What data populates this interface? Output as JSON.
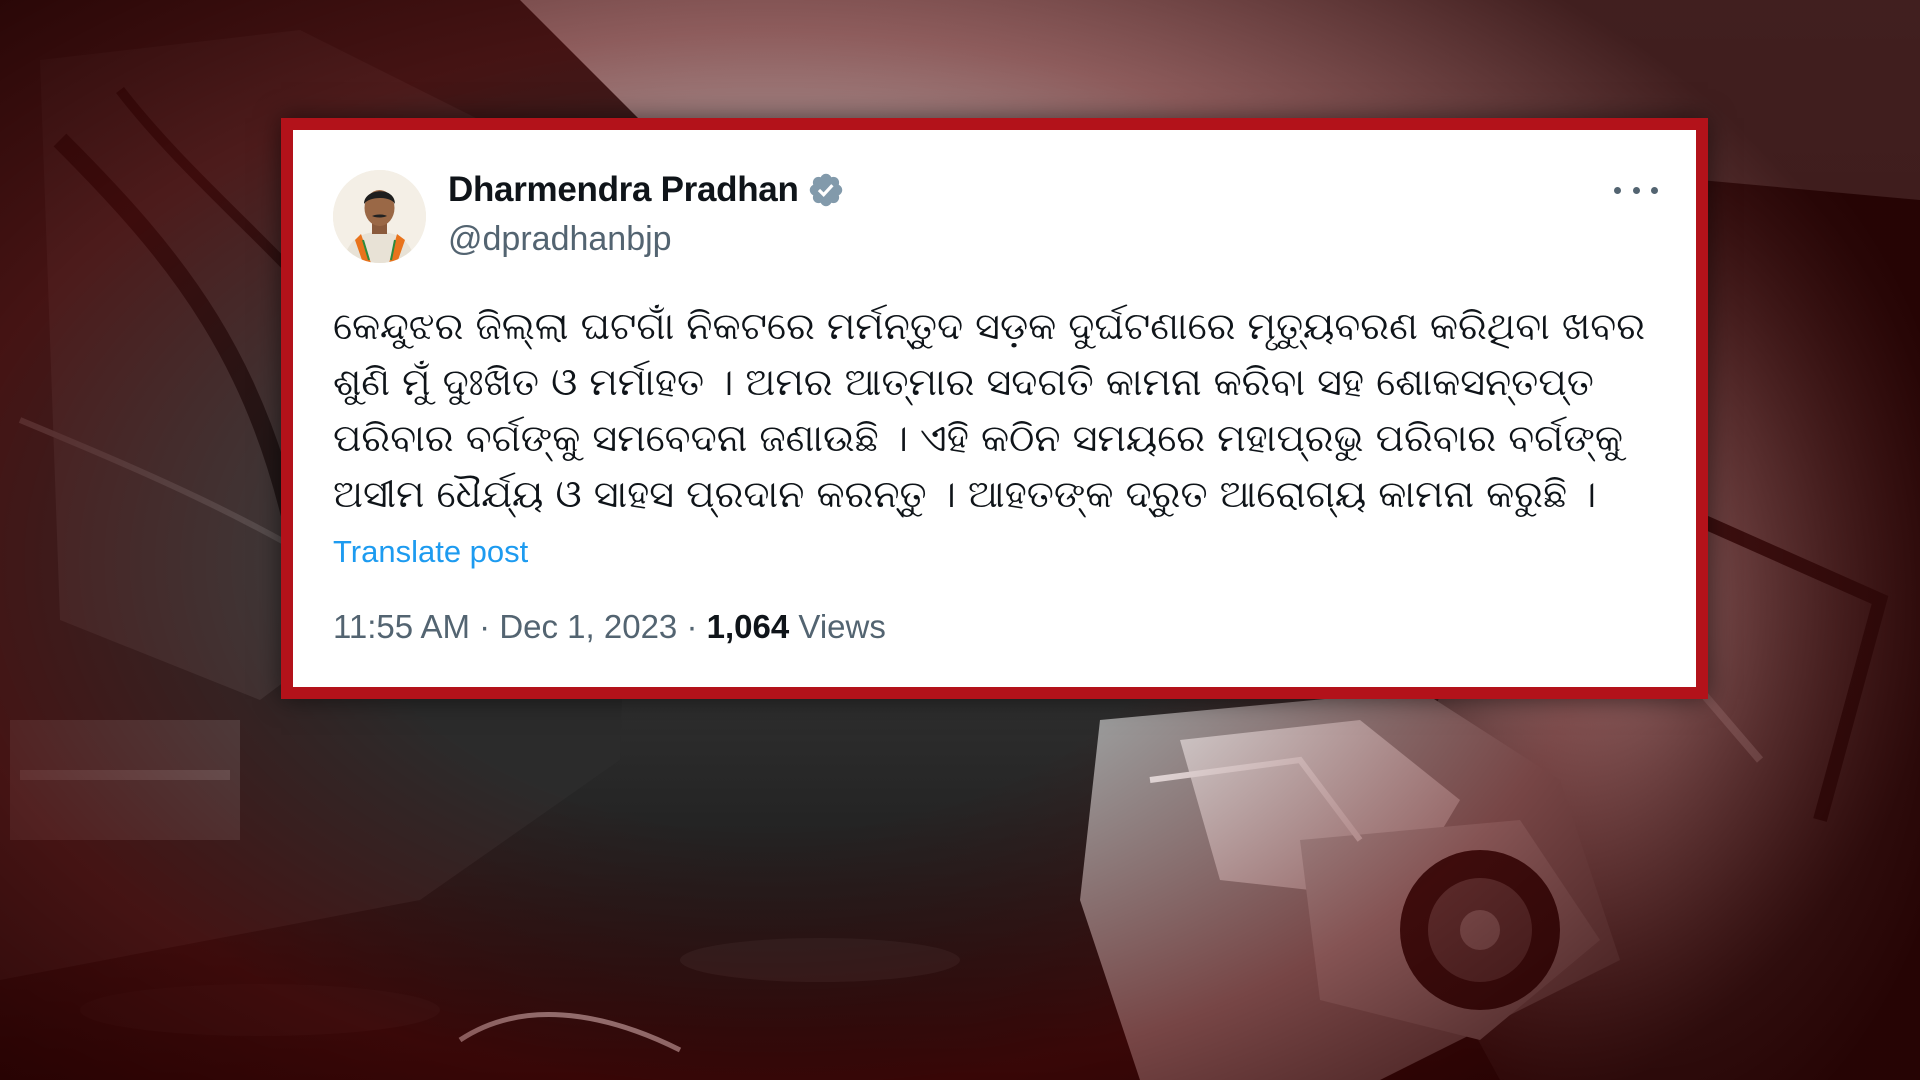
{
  "post": {
    "author_name": "Dharmendra Pradhan",
    "handle": "@dpradhanbjp",
    "text": "କେନ୍ଦୁଝର ଜିଲ୍ଲା ଘଟଗାଁ ନିକଟରେ ମର୍ମନ୍ତୁଦ ସଡ଼କ ଦୁର୍ଘଟଣାରେ ମୃତ୍ୟୁବରଣ କରିଥିବା ଖବର ଶୁଣି ମୁଁ ଦୁଃଖିତ ଓ ମର୍ମାହତ । ଅମର ଆତ୍ମାର ସଦଗତି କାମନା କରିବା ସହ ଶୋକସନ୍ତପ୍ତ ପରିବାର ବର୍ଗଙ୍କୁ ସମବେଦନା ଜଣାଉଛି । ଏହି କଠିନ ସମୟରେ ମହାପ୍ରଭୁ ପରିବାର ବର୍ଗଙ୍କୁ ଅସୀମ ଧୈର୍ଯ୍ୟ ଓ ସାହସ ପ୍ରଦାନ କରନ୍ତୁ । ଆହତଙ୍କ ଦ୍ରୁତ ଆରୋଗ୍ୟ କାମନା କରୁଛି ।",
    "translate_label": "Translate post",
    "time": "11:55 AM",
    "separator": "·",
    "date": "Dec 1, 2023",
    "views_count": "1,064",
    "views_label": "Views"
  },
  "icons": {
    "verified": "verified-badge-icon",
    "more": "more-options-icon"
  },
  "colors": {
    "frame": "#b3121a",
    "verified_blue": "#1d9bf0",
    "link": "#1d9bf0",
    "muted": "#536471"
  }
}
